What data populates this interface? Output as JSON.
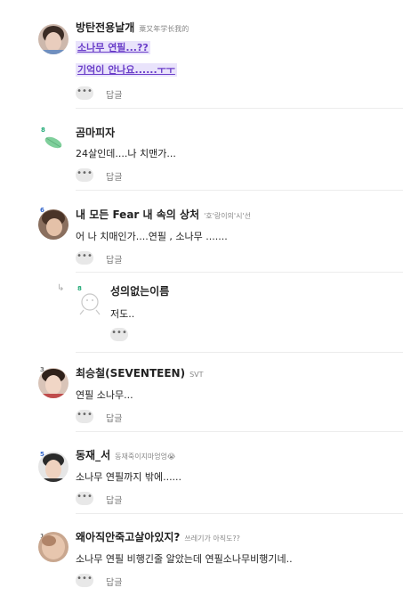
{
  "ui": {
    "more_glyph": "•••",
    "reply_glyph": "↳"
  },
  "comments": [
    {
      "name": "방탄전용날개",
      "tag": "粟又年学长我的",
      "lines": [
        "소나무 연필...??",
        "기억이 안나요......ㅜㅜ"
      ],
      "reply": "답글",
      "level": ""
    },
    {
      "name": "곰마피자",
      "tag": "",
      "lines": [
        "24살인데....나 치맨가..."
      ],
      "reply": "답글",
      "level": "8"
    },
    {
      "name": "내 모든 Fear 내 속의 상처",
      "tag": "'호'랑이의'시'선",
      "lines": [
        "어 나 치매인가....연필 , 소나무 ......."
      ],
      "reply": "답글",
      "level": "6"
    },
    {
      "name": "성의없는이름",
      "tag": "",
      "lines": [
        "저도.."
      ],
      "reply": "",
      "level": "8"
    },
    {
      "name": "최승철(SEVENTEEN)",
      "tag": "SVT",
      "lines": [
        "연필 소나무..."
      ],
      "reply": "답글",
      "level": "3"
    },
    {
      "name": "동재_서",
      "tag": "동재죽이지마엉엉😭",
      "lines": [
        "소나무 연필까지 밖에......"
      ],
      "reply": "답글",
      "level": "5"
    },
    {
      "name": "왜아직안죽고살아있지?",
      "tag": "쓰레기가 아직도??",
      "lines": [
        "소나무 연필 비행긴줄 알았는데 연필소나무비행기네.."
      ],
      "reply": "답글",
      "level": "1"
    }
  ]
}
